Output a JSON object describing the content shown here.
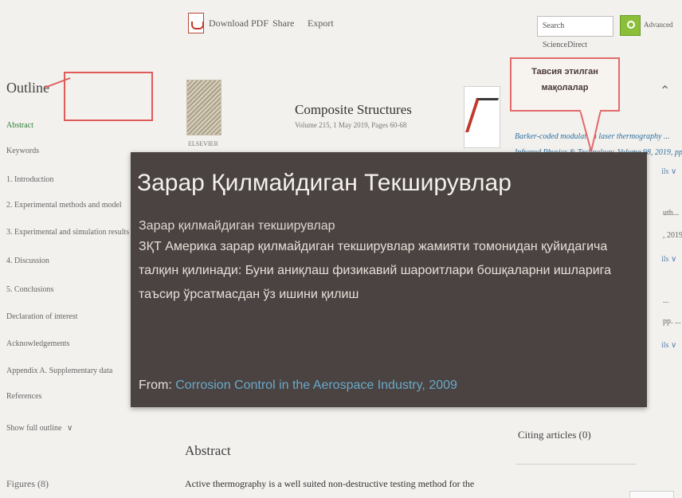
{
  "toolbar": {
    "download_pdf": "Download PDF",
    "share": "Share",
    "export": "Export",
    "search_label": "Search ScienceDirect",
    "advanced": "Advanced"
  },
  "sidebar": {
    "outline_title": "Outline",
    "items": [
      "Abstract",
      "Keywords",
      "1. Introduction",
      "2. Experimental methods and model",
      "3. Experimental and simulation results",
      "4. Discussion",
      "5. Conclusions",
      "Declaration of interest",
      "Acknowledgements",
      "Appendix A. Supplementary data",
      "References"
    ],
    "show_full_outline": "Show full outline",
    "figures": "Figures (8)"
  },
  "journal": {
    "publisher": "ELSEVIER",
    "title": "Composite Structures",
    "meta": "Volume 215, 1 May 2019, Pages 60-68"
  },
  "recommended": {
    "item1_title": "Barker-coded modulation laser thermography ...",
    "item1_source": "Infrared Physics & Technology, Volume 98, 2019, pp. ...",
    "details": "ils",
    "item2_line1": "uth...",
    "item2_line2": ", 2019, ...",
    "item3_line1": "...",
    "item3_line2": "pp. ..."
  },
  "annotation": {
    "callout_line1": "Тавсия этилган",
    "callout_line2": "мақолалар"
  },
  "popup": {
    "title": "Зарар Қилмайдиган Текширувлар",
    "subtitle": "Зарар қилмайдиган текширувлар",
    "body": "ЗҚТ Америка зарар қилмайдиган текширувлар жамияти томонидан қуйидагича талқин қилинади: Буни аниқлаш физикавий шароитлари бошқаларни ишларига таъсир ўрсатмасдан ўз ишини қилиш",
    "from_label": "From:",
    "from_link": "Corrosion Control in the Aerospace Industry, 2009"
  },
  "article": {
    "abstract_heading": "Abstract",
    "abstract_text": "Active thermography is a well suited non-destructive testing method for the"
  },
  "citing": {
    "label": "Citing articles (0)"
  },
  "colors": {
    "popup_bg": "#4a4341",
    "link": "#6aa9c9",
    "annotation_red": "#e15a5a",
    "search_green": "#8bbf3a"
  }
}
